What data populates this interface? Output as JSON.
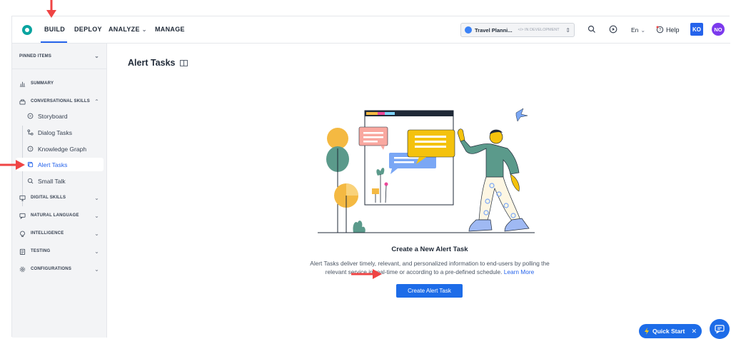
{
  "nav": {
    "items": [
      "BUILD",
      "DEPLOY",
      "ANALYZE",
      "MANAGE"
    ],
    "bot_name": "Travel Planni...",
    "bot_status": "IN DEVELOPMENT",
    "language": "En",
    "help_label": "Help",
    "user_initials": "KO",
    "org_initials": "NO"
  },
  "sidebar": {
    "pinned_label": "PINNED ITEMS",
    "summary_label": "SUMMARY",
    "conversational_label": "CONVERSATIONAL SKILLS",
    "sub_items": [
      "Storyboard",
      "Dialog Tasks",
      "Knowledge Graph",
      "Alert Tasks",
      "Small Talk"
    ],
    "active_item": "Alert Tasks",
    "sections": [
      "DIGITAL SKILLS",
      "NATURAL LANGUAGE",
      "INTELLIGENCE",
      "TESTING",
      "CONFIGURATIONS"
    ]
  },
  "main": {
    "title": "Alert Tasks",
    "heading": "Create a New Alert Task",
    "description_line1": "Alert Tasks deliver timely, relevant, and personalized information to end-users by polling the",
    "description_line2": "relevant service in real-time or according to a pre-defined schedule.",
    "learn_more": "Learn More",
    "cta_label": "Create Alert Task"
  },
  "floating": {
    "quick_start_label": "Quick Start"
  },
  "colors": {
    "accent": "#1d6ce8",
    "annotation_arrow": "#ef4444",
    "teal_logo": "#0aa4a0"
  }
}
